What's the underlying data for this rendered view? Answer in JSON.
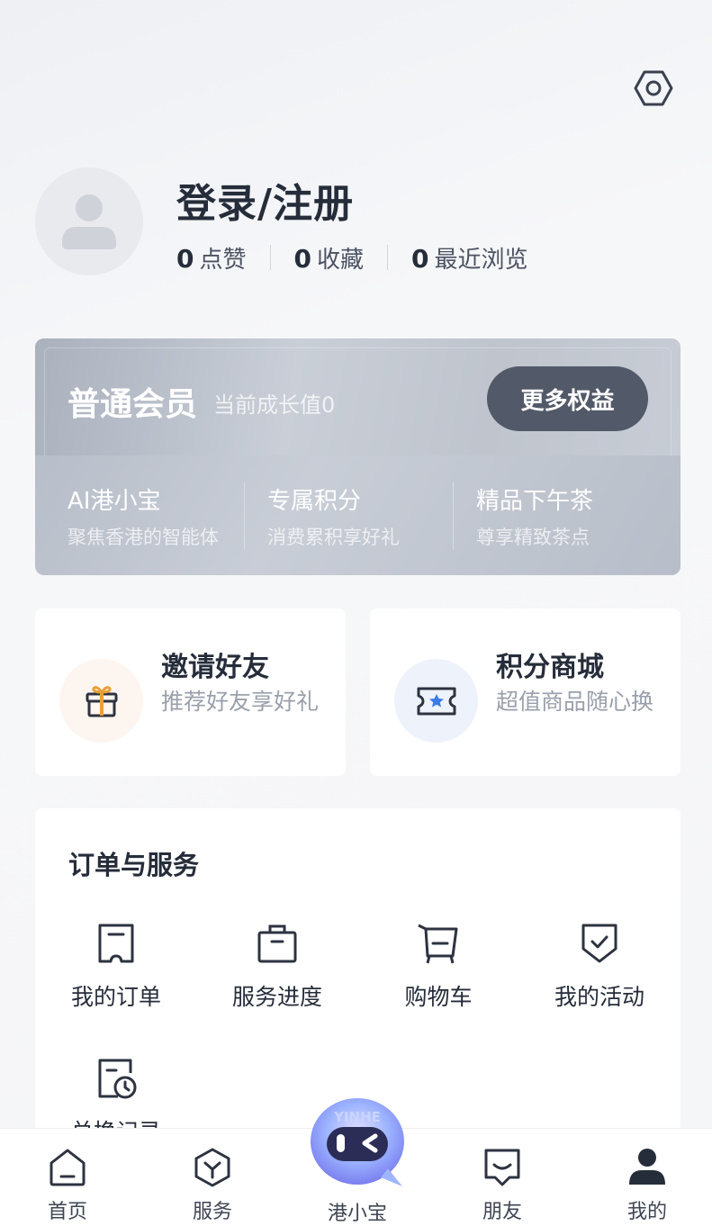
{
  "header": {
    "settings_icon": "settings-hexagon-icon"
  },
  "profile": {
    "avatar_icon": "user-avatar-icon",
    "login_label": "登录/注册",
    "stats": [
      {
        "count": "0",
        "label": "点赞"
      },
      {
        "count": "0",
        "label": "收藏"
      },
      {
        "count": "0",
        "label": "最近浏览"
      }
    ]
  },
  "membership": {
    "level": "普通会员",
    "growth": "当前成长值0",
    "more_button": "更多权益",
    "benefits": [
      {
        "title": "AI港小宝",
        "subtitle": "聚焦香港的智能体"
      },
      {
        "title": "专属积分",
        "subtitle": "消费累积享好礼"
      },
      {
        "title": "精品下午茶",
        "subtitle": "尊享精致茶点"
      }
    ]
  },
  "promos": [
    {
      "title": "邀请好友",
      "desc": "推荐好友享好礼",
      "icon": "gift-icon",
      "icon_color": "#e9a03a",
      "bg": "#fdf5ef"
    },
    {
      "title": "积分商城",
      "desc": "超值商品随心换",
      "icon": "ticket-star-icon",
      "icon_color": "#3b7be8",
      "bg": "#eef3fb"
    }
  ],
  "orders": {
    "title": "订单与服务",
    "items": [
      {
        "label": "我的订单",
        "icon": "order-receipt-icon"
      },
      {
        "label": "服务进度",
        "icon": "briefcase-icon"
      },
      {
        "label": "购物车",
        "icon": "shopping-cart-icon"
      },
      {
        "label": "我的活动",
        "icon": "activity-badge-icon"
      },
      {
        "label": "兑换记录",
        "icon": "exchange-history-icon"
      }
    ]
  },
  "tabbar": {
    "items": [
      {
        "label": "首页",
        "icon": "home-icon"
      },
      {
        "label": "服务",
        "icon": "service-cube-icon"
      },
      {
        "label": "港小宝",
        "icon": "mascot-robot-icon",
        "brand_text": "YINHE"
      },
      {
        "label": "朋友",
        "icon": "friends-chat-icon"
      },
      {
        "label": "我的",
        "icon": "profile-user-icon",
        "active": true
      }
    ]
  },
  "colors": {
    "text_primary": "#262d3a",
    "card_dark_button": "#525969",
    "accent_blue": "#3b7be8",
    "accent_orange": "#e9a03a"
  }
}
